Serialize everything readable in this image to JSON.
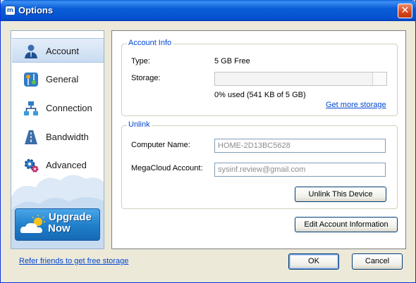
{
  "window": {
    "title": "Options",
    "app_icon_text": "m"
  },
  "sidebar": {
    "items": [
      {
        "label": "Account",
        "icon": "account-icon",
        "selected": true
      },
      {
        "label": "General",
        "icon": "general-icon",
        "selected": false
      },
      {
        "label": "Connection",
        "icon": "connection-icon",
        "selected": false
      },
      {
        "label": "Bandwidth",
        "icon": "bandwidth-icon",
        "selected": false
      },
      {
        "label": "Advanced",
        "icon": "advanced-icon",
        "selected": false
      }
    ],
    "upgrade": {
      "line1": "Upgrade",
      "line2": "Now"
    }
  },
  "account_info": {
    "title": "Account Info",
    "type_label": "Type:",
    "type_value": "5 GB Free",
    "storage_label": "Storage:",
    "storage_used_fraction": 0.0,
    "storage_text": "0% used (541 KB of 5 GB)",
    "more_storage_link": "Get more storage"
  },
  "unlink": {
    "title": "Unlink",
    "computer_name_label": "Computer Name:",
    "computer_name_value": "HOME-2D13BC5628",
    "account_label": "MegaCloud Account:",
    "account_value": "sysinf.review@gmail.com",
    "unlink_button": "Unlink This Device"
  },
  "edit_account_button": "Edit Account Information",
  "footer": {
    "refer_link": "Refer friends to get free storage",
    "ok_button": "OK",
    "cancel_button": "Cancel"
  },
  "colors": {
    "titlebar": "#0550d0",
    "accent_link": "#0046d5",
    "group_title": "#0046d5",
    "selected_nav": "#c9dcf2"
  }
}
